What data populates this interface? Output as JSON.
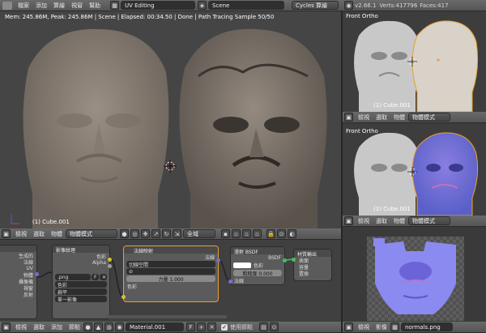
{
  "top_header": {
    "menus": [
      "檔案",
      "添加",
      "算繪",
      "視窗",
      "幫助"
    ],
    "screen_layout": "UV Editing",
    "scene": "Scene",
    "engine": "Cycles 算繪",
    "version": "v2.66.1",
    "verts": "Verts:417796",
    "faces": "Faces:417"
  },
  "info_line": "Mem: 245.86M, Peak: 245.86M | Scene | Elapsed: 00:34.50 | Done | Path Tracing Sample 50/50",
  "main_view": {
    "object_label": "(1) Cube.001"
  },
  "right_top_view": {
    "view_label": "Front Ortho",
    "object_label": "(1) Cube.001"
  },
  "right_mid_view": {
    "view_label": "Front Ortho",
    "object_label": "(1) Cube.001"
  },
  "right_view_header": {
    "menus": [
      "檢視",
      "選取",
      "物體"
    ],
    "mode": "物體模式"
  },
  "uv_header": {
    "menus": [
      "檢視",
      "影像"
    ],
    "image": "normals.png"
  },
  "mid_header": {
    "menus": [
      "檢視",
      "選取",
      "物體"
    ],
    "mode": "物體模式",
    "orientation": "全域"
  },
  "node_header": {
    "menus": [
      "檢視",
      "選取",
      "添加",
      "節點"
    ],
    "material": "Material.001",
    "use_nodes": "使用節點"
  },
  "nodes": {
    "texcoord": {
      "outputs": [
        "生成的",
        "法線",
        "UV",
        "物體",
        "攝像機",
        "視窗",
        "反射"
      ]
    },
    "image": {
      "title": "影像紋理",
      "outputs": [
        "色彩",
        "Alpha"
      ],
      "file": ".png",
      "f": "F",
      "color": "色彩",
      "projection": "扁平",
      "interp": "單一影像"
    },
    "normalmap": {
      "title": "法線映射",
      "output": "法線",
      "space": "切線空間",
      "strength": "力量 1.000",
      "input": "色彩"
    },
    "diffuse": {
      "title": "漫射 BSDF",
      "output": "BSDF",
      "color": "色彩",
      "roughness": "粗糙度 0.000",
      "normal": "法線"
    },
    "output": {
      "title": "材質輸出",
      "inputs": [
        "表面",
        "容量",
        "置換"
      ]
    }
  },
  "colors": {
    "active_node": "#e8a030",
    "socket_yellow": "#d8c030",
    "socket_purple": "#7070d8",
    "socket_gray": "#a0a0a0",
    "socket_green": "#40c060"
  }
}
